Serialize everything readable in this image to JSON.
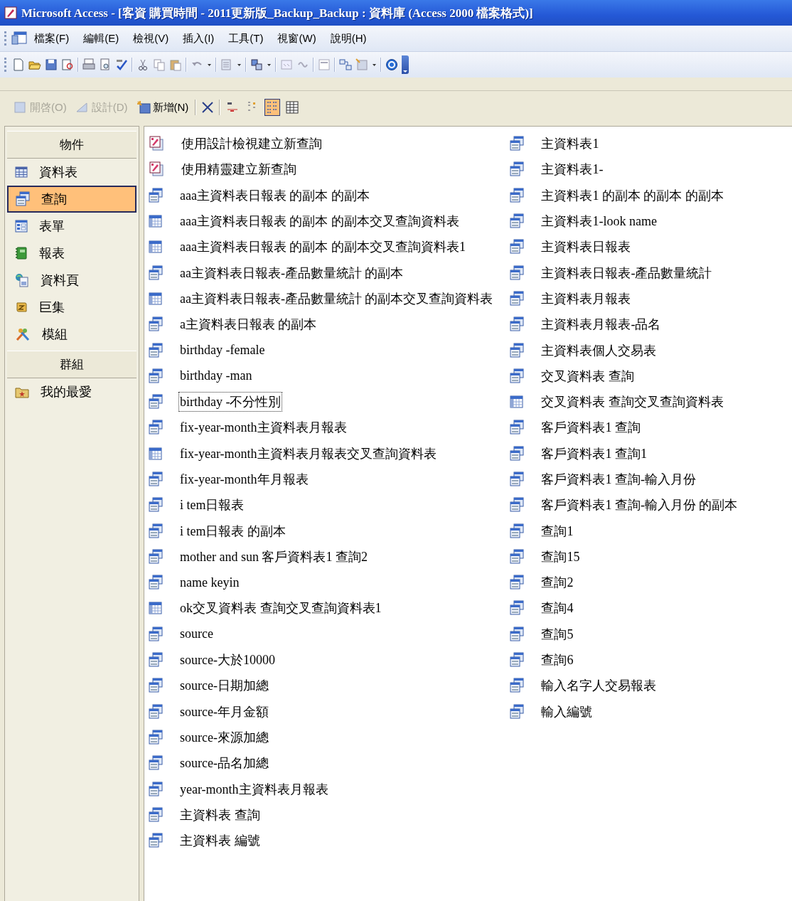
{
  "window": {
    "title": "Microsoft Access - [客資 購買時間 - 2011更新版_Backup_Backup : 資料庫 (Access 2000 檔案格式)]"
  },
  "menu_bar": {
    "items": [
      {
        "label": "檔案(F)"
      },
      {
        "label": "編輯(E)"
      },
      {
        "label": "檢視(V)"
      },
      {
        "label": "插入(I)"
      },
      {
        "label": "工具(T)"
      },
      {
        "label": "視窗(W)"
      },
      {
        "label": "說明(H)"
      }
    ]
  },
  "object_toolbar": {
    "buttons": [
      {
        "kind": "open",
        "label": "開啓(O)",
        "disabled": true
      },
      {
        "kind": "design",
        "label": "設計(D)",
        "disabled": true
      },
      {
        "kind": "new",
        "label": "新增(N)",
        "disabled": false
      }
    ],
    "views": [
      {
        "kind": "large-icons",
        "selected": false
      },
      {
        "kind": "small-icons",
        "selected": false
      },
      {
        "kind": "list",
        "selected": true
      },
      {
        "kind": "details",
        "selected": false
      }
    ]
  },
  "sidebar": {
    "sections": [
      {
        "header": "物件",
        "items": [
          {
            "kind": "table",
            "label": "資料表",
            "selected": false
          },
          {
            "kind": "query",
            "label": "查詢",
            "selected": true
          },
          {
            "kind": "form",
            "label": "表單",
            "selected": false
          },
          {
            "kind": "report",
            "label": "報表",
            "selected": false
          },
          {
            "kind": "page",
            "label": "資料頁",
            "selected": false
          },
          {
            "kind": "macro",
            "label": "巨集",
            "selected": false
          },
          {
            "kind": "module",
            "label": "模組",
            "selected": false
          }
        ]
      },
      {
        "header": "群組",
        "items": [
          {
            "kind": "favorites",
            "label": "我的最愛",
            "selected": false
          }
        ]
      }
    ]
  },
  "object_list": {
    "items": [
      {
        "kind": "wizard",
        "label": "使用設計檢視建立新查詢",
        "focused": false
      },
      {
        "kind": "wizard",
        "label": "使用精靈建立新查詢",
        "focused": false
      },
      {
        "kind": "query",
        "label": "aaa主資料表日報表 的副本 的副本",
        "focused": false
      },
      {
        "kind": "crosstab",
        "label": "aaa主資料表日報表 的副本 的副本交叉查詢資料表",
        "focused": false
      },
      {
        "kind": "crosstab",
        "label": "aaa主資料表日報表 的副本 的副本交叉查詢資料表1",
        "focused": false
      },
      {
        "kind": "query",
        "label": "aa主資料表日報表-產品數量統計 的副本",
        "focused": false
      },
      {
        "kind": "crosstab",
        "label": "aa主資料表日報表-產品數量統計 的副本交叉查詢資料表",
        "focused": false
      },
      {
        "kind": "query",
        "label": "a主資料表日報表 的副本",
        "focused": false
      },
      {
        "kind": "query",
        "label": "birthday -female",
        "focused": false
      },
      {
        "kind": "query",
        "label": "birthday -man",
        "focused": false
      },
      {
        "kind": "query",
        "label": "birthday -不分性別",
        "focused": true
      },
      {
        "kind": "query",
        "label": "fix-year-month主資料表月報表",
        "focused": false
      },
      {
        "kind": "crosstab",
        "label": "fix-year-month主資料表月報表交叉查詢資料表",
        "focused": false
      },
      {
        "kind": "query",
        "label": "fix-year-month年月報表",
        "focused": false
      },
      {
        "kind": "query",
        "label": "i tem日報表",
        "focused": false
      },
      {
        "kind": "query",
        "label": "i tem日報表 的副本",
        "focused": false
      },
      {
        "kind": "query",
        "label": "mother and sun 客戶資料表1  查詢2",
        "focused": false
      },
      {
        "kind": "query",
        "label": "name keyin",
        "focused": false
      },
      {
        "kind": "crosstab",
        "label": "ok交叉資料表 查詢交叉查詢資料表1",
        "focused": false
      },
      {
        "kind": "query",
        "label": "source",
        "focused": false
      },
      {
        "kind": "query",
        "label": "source-大於10000",
        "focused": false
      },
      {
        "kind": "query",
        "label": "source-日期加總",
        "focused": false
      },
      {
        "kind": "query",
        "label": "source-年月金額",
        "focused": false
      },
      {
        "kind": "query",
        "label": "source-來源加總",
        "focused": false
      },
      {
        "kind": "query",
        "label": "source-品名加總",
        "focused": false
      },
      {
        "kind": "query",
        "label": "year-month主資料表月報表",
        "focused": false
      },
      {
        "kind": "query",
        "label": "主資料表 查詢",
        "focused": false
      },
      {
        "kind": "query",
        "label": "主資料表 編號",
        "focused": false
      },
      {
        "kind": "query",
        "label": "主資料表1",
        "focused": false
      },
      {
        "kind": "query",
        "label": "主資料表1-",
        "focused": false
      },
      {
        "kind": "query",
        "label": "主資料表1 的副本 的副本 的副本",
        "focused": false
      },
      {
        "kind": "query",
        "label": "主資料表1-look name",
        "focused": false
      },
      {
        "kind": "query",
        "label": "主資料表日報表",
        "focused": false
      },
      {
        "kind": "query",
        "label": "主資料表日報表-產品數量統計",
        "focused": false
      },
      {
        "kind": "query",
        "label": "主資料表月報表",
        "focused": false
      },
      {
        "kind": "query",
        "label": "主資料表月報表-品名",
        "focused": false
      },
      {
        "kind": "query",
        "label": "主資料表個人交易表",
        "focused": false
      },
      {
        "kind": "query",
        "label": "交叉資料表 查詢",
        "focused": false
      },
      {
        "kind": "crosstab",
        "label": "交叉資料表 查詢交叉查詢資料表",
        "focused": false
      },
      {
        "kind": "query",
        "label": "客戶資料表1 查詢",
        "focused": false
      },
      {
        "kind": "query",
        "label": "客戶資料表1 查詢1",
        "focused": false
      },
      {
        "kind": "query",
        "label": "客戶資料表1 查詢-輸入月份",
        "focused": false
      },
      {
        "kind": "query",
        "label": "客戶資料表1 查詢-輸入月份 的副本",
        "focused": false
      },
      {
        "kind": "query",
        "label": "查詢1",
        "focused": false
      },
      {
        "kind": "query",
        "label": "查詢15",
        "focused": false
      },
      {
        "kind": "query",
        "label": "查詢2",
        "focused": false
      },
      {
        "kind": "query",
        "label": "查詢4",
        "focused": false
      },
      {
        "kind": "query",
        "label": "查詢5",
        "focused": false
      },
      {
        "kind": "query",
        "label": "查詢6",
        "focused": false
      },
      {
        "kind": "query",
        "label": "輸入名字人交易報表",
        "focused": false
      },
      {
        "kind": "query",
        "label": "輸入編號",
        "focused": false
      }
    ]
  }
}
